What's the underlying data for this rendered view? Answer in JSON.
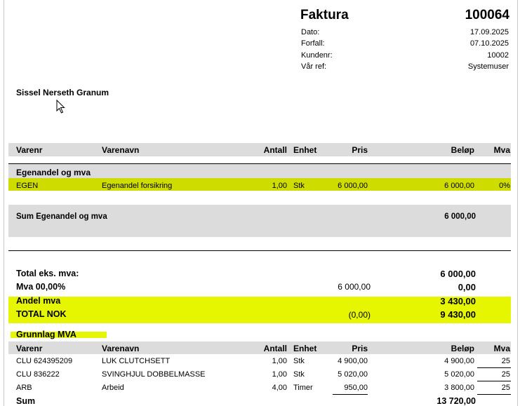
{
  "invoice": {
    "title": "Faktura",
    "number": "100064",
    "meta": [
      {
        "label": "Dato:",
        "value": "17.09.2025"
      },
      {
        "label": "Forfall:",
        "value": "07.10.2025"
      },
      {
        "label": "Kundenr:",
        "value": "10002"
      },
      {
        "label": "Vår ref:",
        "value": "Systemuser"
      }
    ]
  },
  "customer": {
    "name": "Sissel Nerseth Granum"
  },
  "columns": {
    "varenr": "Varenr",
    "varenavn": "Varenavn",
    "antall": "Antall",
    "enhet": "Enhet",
    "pris": "Pris",
    "belop": "Beløp",
    "mva": "Mva"
  },
  "group": {
    "title": "Egenandel og mva",
    "row": {
      "varenr": "EGEN",
      "varenavn": "Egenandel forsikring",
      "antall": "1,00",
      "enhet": "Stk",
      "pris": "6 000,00",
      "belop": "6 000,00",
      "mva": "0%"
    },
    "sum_label": "Sum Egenandel og mva",
    "sum_value": "6 000,00"
  },
  "totals": {
    "eks_label": "Total eks. mva:",
    "eks_value": "6 000,00",
    "mva_label": "Mva 00,00%",
    "mva_base": "6 000,00",
    "mva_value": "0,00",
    "andel_label": "Andel mva",
    "andel_value": "3 430,00",
    "total_label": "TOTAL NOK",
    "total_paren": "(0,00)",
    "total_value": "9 430,00"
  },
  "grunnlag": {
    "title": "Grunnlag MVA",
    "rows": [
      {
        "varenr": "CLU 624395209",
        "varenavn": "LUK CLUTCHSETT",
        "antall": "1,00",
        "enhet": "Stk",
        "pris": "4 900,00",
        "belop": "4 900,00",
        "mva": "25"
      },
      {
        "varenr": "CLU 836222",
        "varenavn": "SVINGHJUL DOBBELMASSE",
        "antall": "1,00",
        "enhet": "Stk",
        "pris": "5 020,00",
        "belop": "5 020,00",
        "mva": "25"
      },
      {
        "varenr": "ARB",
        "varenavn": "Arbeid",
        "antall": "4,00",
        "enhet": "Timer",
        "pris": "950,00",
        "belop": "3 800,00",
        "mva": "25"
      }
    ],
    "sum_label": "Sum",
    "sum_value": "13 720,00"
  },
  "colors": {
    "highlight": "#e6f500",
    "group_highlight": "#cfdc00",
    "band_gray": "#dcdcdc"
  }
}
